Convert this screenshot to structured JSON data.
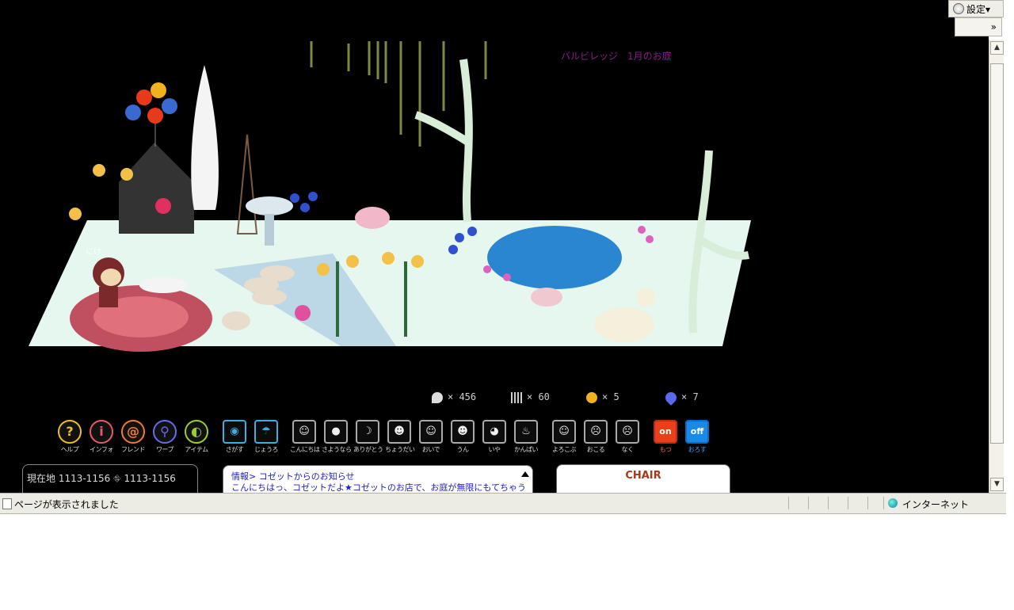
{
  "browser": {
    "settings_label": "設定▾",
    "expand_label": "»",
    "status_message": "ページが表示されました",
    "zone_label": "インターネット"
  },
  "garden": {
    "title": "バルビレッジ　1月のお庭"
  },
  "counters": [
    {
      "icon": "seed-icon",
      "value": "× 456"
    },
    {
      "icon": "leaf-icon",
      "value": "× 60"
    },
    {
      "icon": "coin-icon",
      "value": "× 5"
    },
    {
      "icon": "pin-icon",
      "value": "× 7"
    }
  ],
  "nav_tools": [
    {
      "icon": "help-icon",
      "glyph": "?",
      "label": "ヘルプ",
      "color": "#f0c020"
    },
    {
      "icon": "info-icon",
      "glyph": "i",
      "label": "インフォ",
      "color": "#e85a6a"
    },
    {
      "icon": "friend-icon",
      "glyph": "@",
      "label": "フレンド",
      "color": "#f07a30"
    },
    {
      "icon": "warp-icon",
      "glyph": "⚲",
      "label": "ワープ",
      "color": "#6a6af0"
    },
    {
      "icon": "item-icon",
      "glyph": "◐",
      "label": "アイテム",
      "color": "#9acd32"
    }
  ],
  "action_tools": [
    {
      "icon": "search-icon",
      "glyph": "◉",
      "label": "さがす",
      "color": "#3ab0e0"
    },
    {
      "icon": "watering-can-icon",
      "glyph": "☂",
      "label": "じょうろ",
      "color": "#3ab0e0"
    }
  ],
  "emotes": [
    {
      "icon": "hello-icon",
      "label": "こんにちは"
    },
    {
      "icon": "goodbye-icon",
      "label": "さようなら"
    },
    {
      "icon": "thanks-icon",
      "label": "ありがとう"
    },
    {
      "icon": "give-icon",
      "label": "ちょうだい"
    },
    {
      "icon": "come-icon",
      "label": "おいで"
    },
    {
      "icon": "yes-icon",
      "label": "うん"
    },
    {
      "icon": "no-icon",
      "label": "いや"
    },
    {
      "icon": "cheers-icon",
      "label": "かんぱい"
    },
    {
      "icon": "happy-icon",
      "label": "よろこぶ"
    },
    {
      "icon": "angry-icon",
      "label": "おこる"
    },
    {
      "icon": "cry-icon",
      "label": "なく"
    }
  ],
  "switches": [
    {
      "icon": "pickup-on-icon",
      "glyph": "on",
      "label": "もつ",
      "color": "#e8401a",
      "label_color": "#ff6a3a"
    },
    {
      "icon": "putdown-off-icon",
      "glyph": "off",
      "label": "おろす",
      "color": "#1a8ae8",
      "label_color": "#3aa0ff"
    }
  ],
  "location": {
    "text": "現在地 1113-1156  ⛗ 1113-1156"
  },
  "info": {
    "line1": "情報> コゼットからのお知らせ",
    "line2": "こんにちはっ、コゼットだよ★コゼットのお店で、お庭が無限にもてちゃう"
  },
  "selected_item": {
    "name": "CHAIR"
  },
  "character": {
    "name": "にけ"
  }
}
